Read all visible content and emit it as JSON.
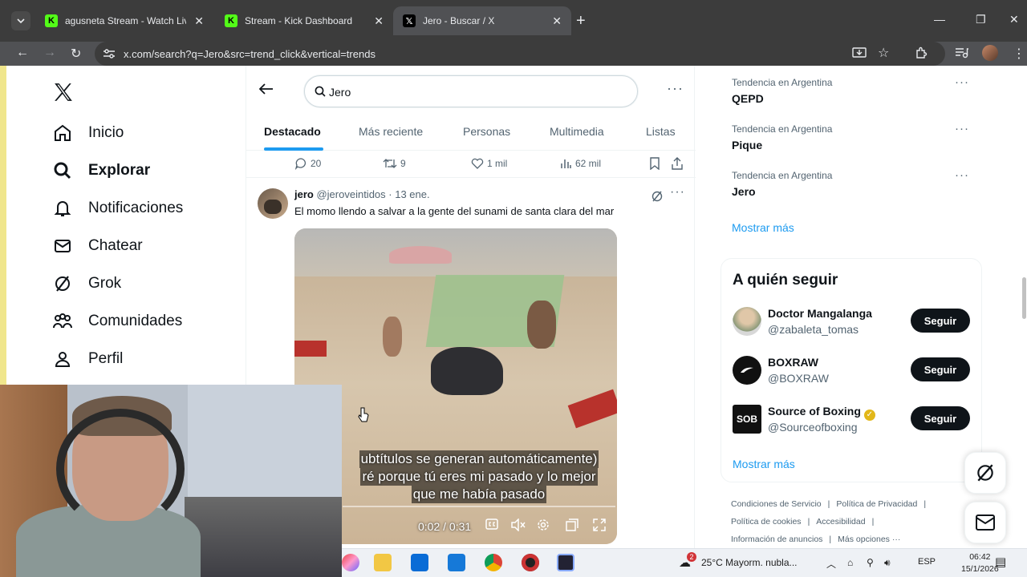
{
  "browser": {
    "tabs": [
      {
        "title": "agusneta Stream - Watch Live o",
        "close": "✕"
      },
      {
        "title": "Stream - Kick Dashboard",
        "close": "✕"
      },
      {
        "title": "Jero - Buscar / X",
        "close": "✕"
      }
    ],
    "new_tab": "+",
    "address": "x.com/search?q=Jero&src=trend_click&vertical=trends"
  },
  "sidebar": {
    "items": [
      {
        "label": "Inicio",
        "icon": "home-icon"
      },
      {
        "label": "Explorar",
        "icon": "search-icon"
      },
      {
        "label": "Notificaciones",
        "icon": "bell-icon"
      },
      {
        "label": "Chatear",
        "icon": "mail-icon"
      },
      {
        "label": "Grok",
        "icon": "grok-icon"
      },
      {
        "label": "Comunidades",
        "icon": "people-icon"
      },
      {
        "label": "Perfil",
        "icon": "person-icon"
      }
    ]
  },
  "search": {
    "value": "Jero"
  },
  "search_tabs": [
    "Destacado",
    "Más reciente",
    "Personas",
    "Multimedia",
    "Listas"
  ],
  "prev_tweet_actions": {
    "replies": "20",
    "reposts": "9",
    "likes": "1 mil",
    "views": "62 mil"
  },
  "tweet": {
    "name": "jero",
    "handle": "@jeroveintidos",
    "date": "· 13 ene.",
    "text": "El momo llendo a salvar a la gente del sunami de santa clara del mar",
    "video_time": "0:02 / 0:31",
    "subtitles": [
      "ubtítulos se generan automáticamente)",
      "ré porque tú eres mi pasado y lo mejor",
      "que me había pasado"
    ]
  },
  "trends": [
    {
      "label": "Tendencia en Argentina",
      "topic": "QEPD"
    },
    {
      "label": "Tendencia en Argentina",
      "topic": "Pique"
    },
    {
      "label": "Tendencia en Argentina",
      "topic": "Jero"
    }
  ],
  "show_more": "Mostrar más",
  "who_to_follow": {
    "title": "A quién seguir",
    "accounts": [
      {
        "name": "Doctor Mangalanga",
        "handle": "@zabaleta_tomas",
        "button": "Seguir"
      },
      {
        "name": "BOXRAW",
        "handle": "@BOXRAW",
        "button": "Seguir"
      },
      {
        "name": "Source of Boxing",
        "handle": "@Sourceofboxing",
        "button": "Seguir"
      }
    ],
    "show_more": "Mostrar más"
  },
  "footer": [
    "Condiciones de Servicio",
    "Política de Privacidad",
    "Política de cookies",
    "Accesibilidad",
    "Información de anuncios",
    "Más opciones ···"
  ],
  "taskbar": {
    "weather_badge": "2",
    "weather": "25°C  Mayorm. nubla...",
    "lang": "ESP",
    "time": "06:42",
    "date": "15/1/2026"
  },
  "colors": {
    "accent": "#1d9bf0",
    "text": "#0f1419",
    "muted": "#536471"
  }
}
